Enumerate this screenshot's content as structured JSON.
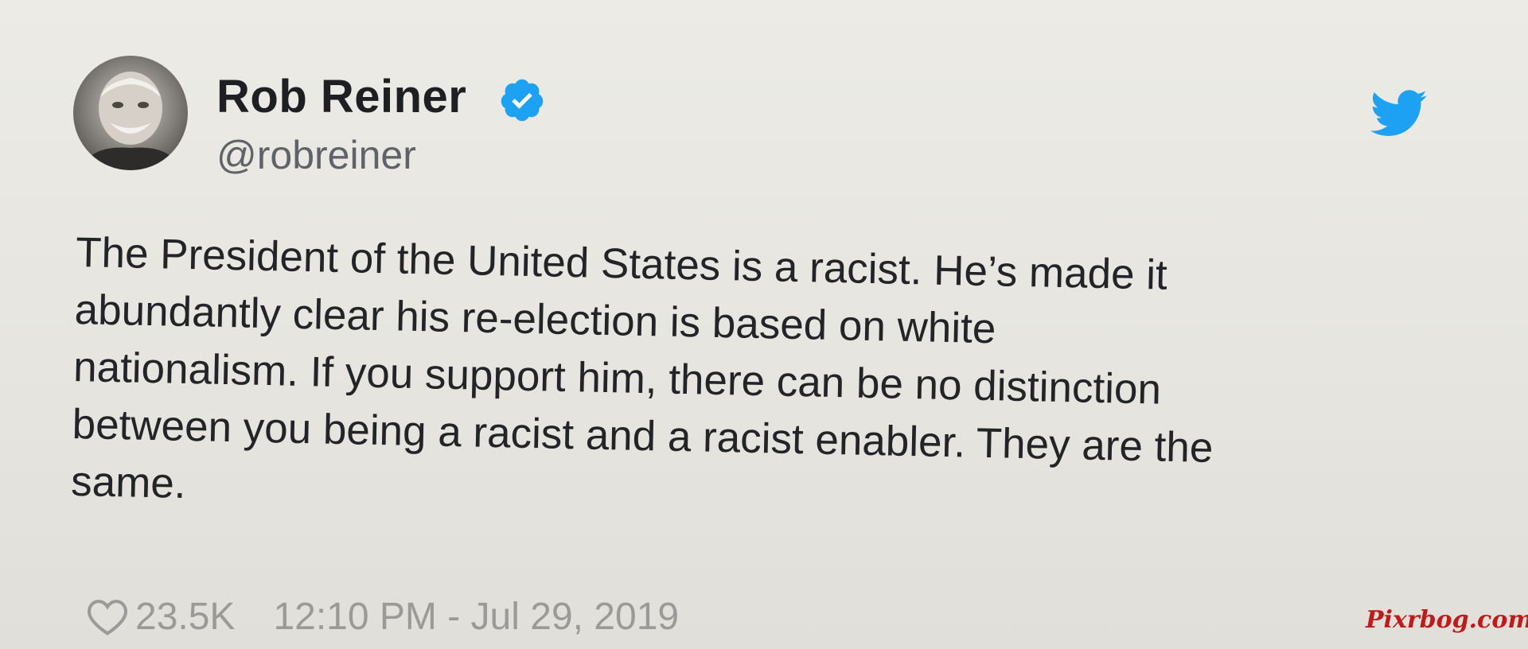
{
  "tweet": {
    "author": {
      "name": "Rob Reiner",
      "handle": "@robreiner",
      "verified": true,
      "avatar_icon": "profile-photo"
    },
    "text_lines": [
      "The President of the United States is a racist. He’s made it",
      "abundantly clear his re-election is based on white",
      "nationalism. If you support him, there can be no distinction",
      "between you being a racist and a racist enabler. They are the",
      "same."
    ],
    "likes": "23.5K",
    "timestamp": "12:10 PM - Jul 29, 2019"
  },
  "watermark": "Pixrbog.com",
  "colors": {
    "verified_blue": "#1da1f2",
    "twitter_blue": "#1da1f2",
    "text_dark": "#232427",
    "meta_gray": "#9b9a98",
    "watermark_red": "#c21a1a"
  }
}
